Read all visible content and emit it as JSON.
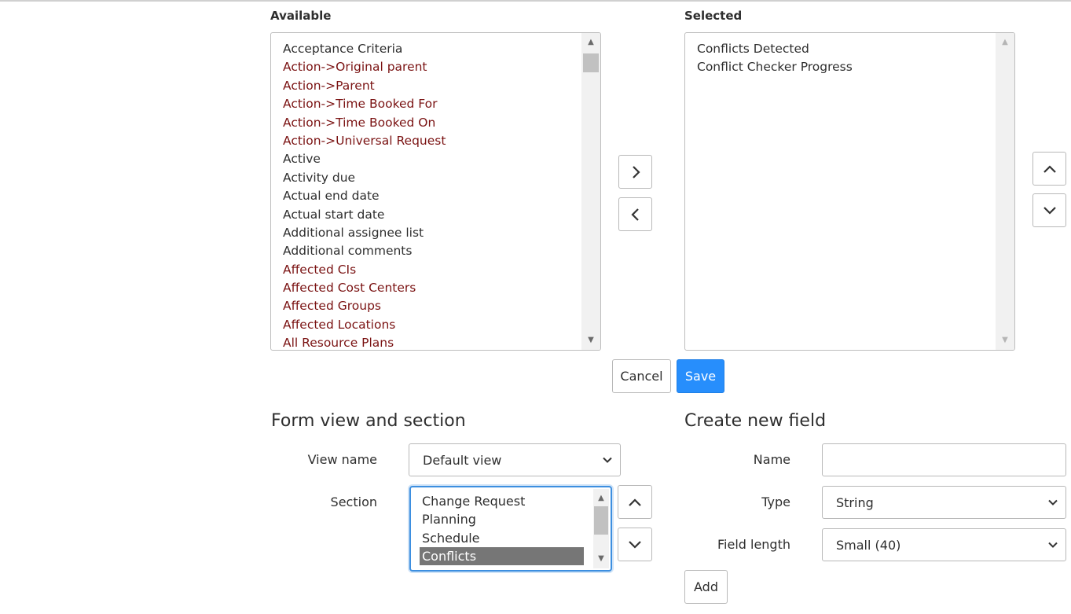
{
  "available": {
    "title": "Available",
    "items": [
      {
        "label": "Acceptance Criteria",
        "reference": false
      },
      {
        "label": "Action->Original parent",
        "reference": true
      },
      {
        "label": "Action->Parent",
        "reference": true
      },
      {
        "label": "Action->Time Booked For",
        "reference": true
      },
      {
        "label": "Action->Time Booked On",
        "reference": true
      },
      {
        "label": "Action->Universal Request",
        "reference": true
      },
      {
        "label": "Active",
        "reference": false
      },
      {
        "label": "Activity due",
        "reference": false
      },
      {
        "label": "Actual end date",
        "reference": false
      },
      {
        "label": "Actual start date",
        "reference": false
      },
      {
        "label": "Additional assignee list",
        "reference": false
      },
      {
        "label": "Additional comments",
        "reference": false
      },
      {
        "label": "Affected CIs",
        "reference": true
      },
      {
        "label": "Affected Cost Centers",
        "reference": true
      },
      {
        "label": "Affected Groups",
        "reference": true
      },
      {
        "label": "Affected Locations",
        "reference": true
      },
      {
        "label": "All Resource Plans",
        "reference": true
      }
    ]
  },
  "selected": {
    "title": "Selected",
    "items": [
      {
        "label": "Conflicts Detected"
      },
      {
        "label": "Conflict Checker Progress"
      }
    ]
  },
  "transfer": {
    "add_icon": "chevron-right-icon",
    "remove_icon": "chevron-left-icon",
    "move_up_icon": "chevron-up-icon",
    "move_down_icon": "chevron-down-icon"
  },
  "actions": {
    "cancel_label": "Cancel",
    "save_label": "Save"
  },
  "form_view": {
    "heading": "Form view and section",
    "view_name_label": "View name",
    "view_name_value": "Default view",
    "section_label": "Section",
    "sections": [
      {
        "label": "Change Request",
        "selected": false
      },
      {
        "label": "Planning",
        "selected": false
      },
      {
        "label": "Schedule",
        "selected": false
      },
      {
        "label": "Conflicts",
        "selected": true
      }
    ]
  },
  "new_field": {
    "heading": "Create new field",
    "name_label": "Name",
    "name_value": "",
    "type_label": "Type",
    "type_value": "String",
    "length_label": "Field length",
    "length_value": "Small (40)",
    "add_label": "Add"
  },
  "colors": {
    "primary": "#278efc",
    "reference_text": "#7a1212",
    "selection_bg": "#767676",
    "focus_border": "#3d8fe0"
  }
}
